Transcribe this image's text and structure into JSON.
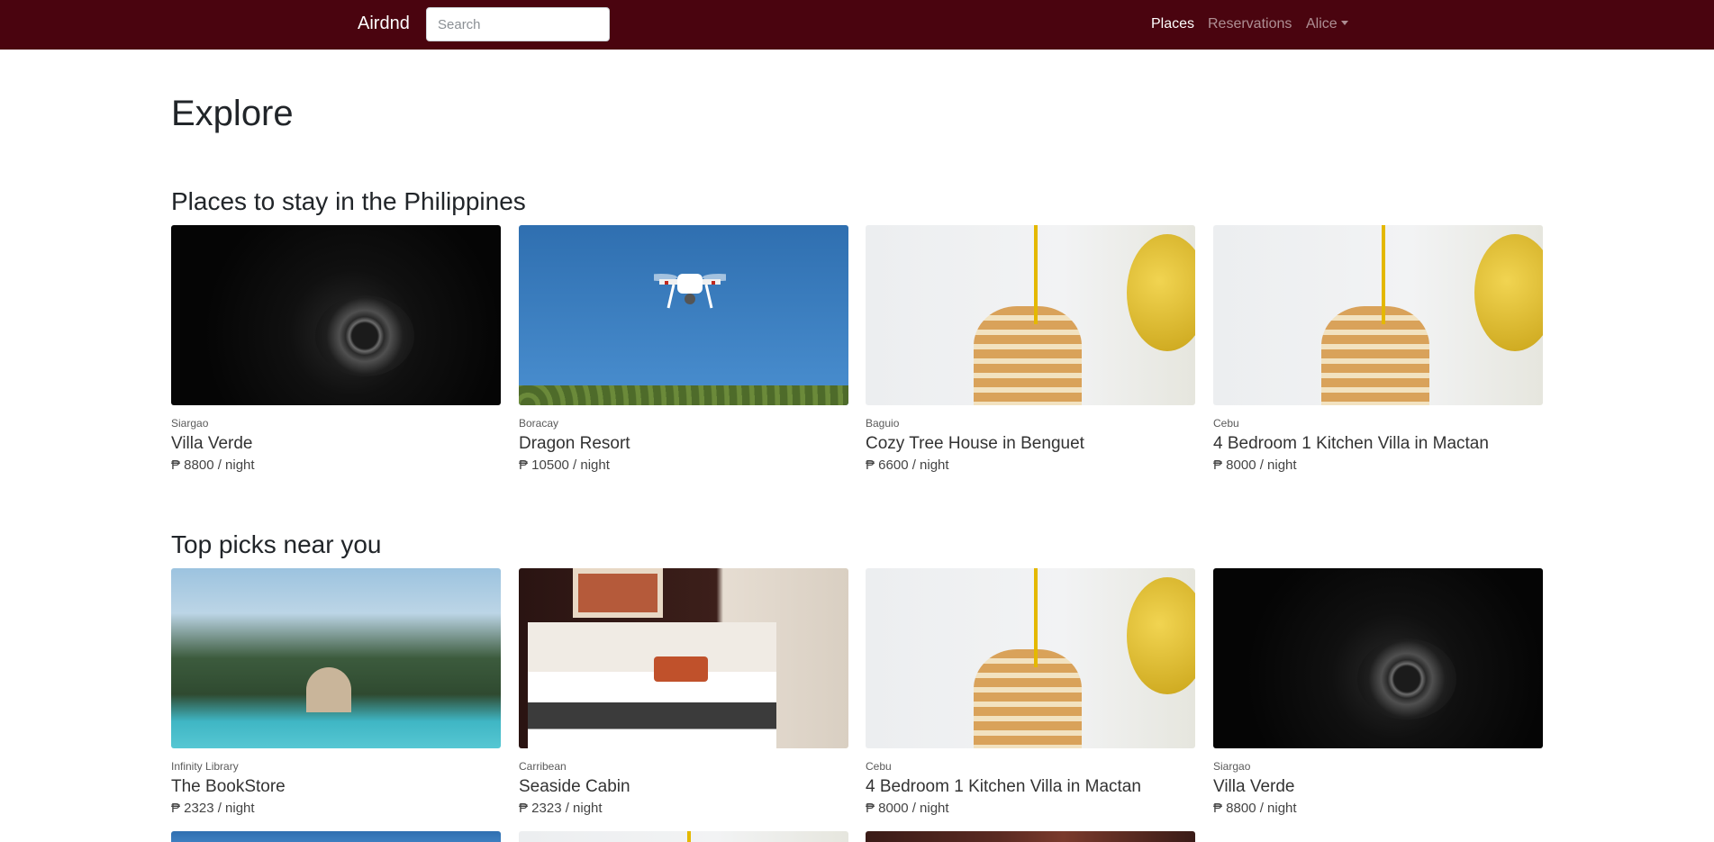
{
  "navbar": {
    "brand": "Airdnd",
    "search_placeholder": "Search",
    "links": {
      "places": "Places",
      "reservations": "Reservations",
      "user": "Alice"
    },
    "background_color": "#4a040f"
  },
  "page": {
    "title": "Explore",
    "sections": [
      {
        "title": "Places to stay in the Philippines",
        "cards": [
          {
            "location": "Siargao",
            "name": "Villa Verde",
            "price": "₱ 8800 / night",
            "image": "camera-lens"
          },
          {
            "location": "Boracay",
            "name": "Dragon Resort",
            "price": "₱ 10500 / night",
            "image": "drone-sky"
          },
          {
            "location": "Baguio",
            "name": "Cozy Tree House in Benguet",
            "price": "₱ 6600 / night",
            "image": "pancakes-honey"
          },
          {
            "location": "Cebu",
            "name": "4 Bedroom 1 Kitchen Villa in Mactan",
            "price": "₱ 8000 / night",
            "image": "pancakes-honey"
          }
        ]
      },
      {
        "title": "Top picks near you",
        "cards": [
          {
            "location": "Infinity Library",
            "name": "The BookStore",
            "price": "₱ 2323 / night",
            "image": "palm-pool"
          },
          {
            "location": "Carribean",
            "name": "Seaside Cabin",
            "price": "₱ 2323 / night",
            "image": "hotel-bedroom"
          },
          {
            "location": "Cebu",
            "name": "4 Bedroom 1 Kitchen Villa in Mactan",
            "price": "₱ 8000 / night",
            "image": "pancakes-honey"
          },
          {
            "location": "Siargao",
            "name": "Villa Verde",
            "price": "₱ 8800 / night",
            "image": "camera-lens"
          }
        ]
      }
    ]
  }
}
